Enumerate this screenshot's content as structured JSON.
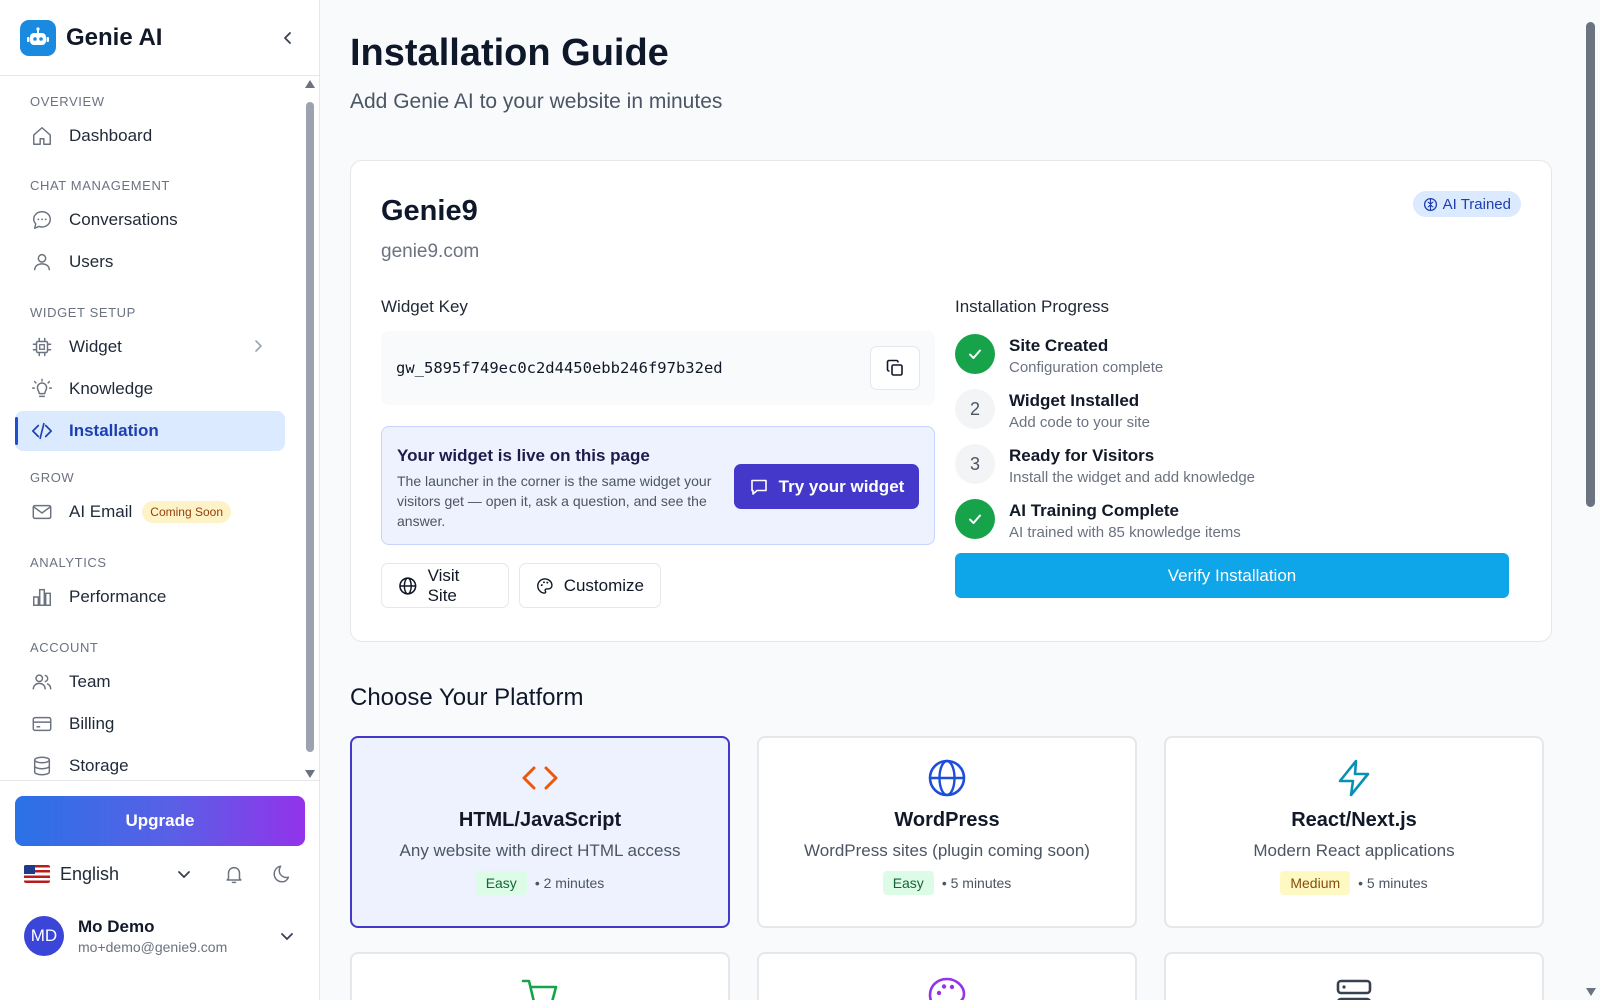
{
  "app": {
    "name": "Genie AI"
  },
  "sidebar": {
    "sections": [
      {
        "label": "OVERVIEW"
      },
      {
        "label": "CHAT MANAGEMENT"
      },
      {
        "label": "WIDGET SETUP"
      },
      {
        "label": "GROW"
      },
      {
        "label": "ANALYTICS"
      },
      {
        "label": "ACCOUNT"
      }
    ],
    "items": {
      "dashboard": "Dashboard",
      "conversations": "Conversations",
      "users": "Users",
      "widget": "Widget",
      "knowledge": "Knowledge",
      "installation": "Installation",
      "ai_email": "AI Email",
      "ai_email_badge": "Coming Soon",
      "performance": "Performance",
      "team": "Team",
      "billing": "Billing",
      "storage": "Storage"
    },
    "active_item": "Installation"
  },
  "footer": {
    "upgrade_label": "Upgrade",
    "language": "English",
    "user": {
      "initials": "MD",
      "name": "Mo Demo",
      "email": "mo+demo@genie9.com"
    }
  },
  "page": {
    "title": "Installation Guide",
    "subtitle": "Add Genie AI to your website in minutes"
  },
  "site": {
    "name": "Genie9",
    "domain": "genie9.com",
    "badge": "AI Trained",
    "widget_key_label": "Widget Key",
    "widget_key": "gw_5895f749ec0c2d4450ebb246f97b32ed",
    "live": {
      "title": "Your widget is live on this page",
      "description": "The launcher in the corner is the same widget your visitors get — open it, ask a question, and see the answer.",
      "button": "Try your widget"
    },
    "visit_label": "Visit Site",
    "customize_label": "Customize"
  },
  "progress": {
    "label": "Installation Progress",
    "steps": [
      {
        "status": "done",
        "marker": "",
        "title": "Site Created",
        "desc": "Configuration complete"
      },
      {
        "status": "todo",
        "marker": "2",
        "title": "Widget Installed",
        "desc": "Add code to your site"
      },
      {
        "status": "todo",
        "marker": "3",
        "title": "Ready for Visitors",
        "desc": "Install the widget and add knowledge"
      },
      {
        "status": "done",
        "marker": "",
        "title": "AI Training Complete",
        "desc": "AI trained with 85 knowledge items"
      }
    ],
    "verify_label": "Verify Installation"
  },
  "platforms": {
    "heading": "Choose Your Platform",
    "items": [
      {
        "name": "HTML/JavaScript",
        "desc": "Any website with direct HTML access",
        "difficulty": "Easy",
        "time": "• 2 minutes",
        "icon": "code-icon",
        "selected": true
      },
      {
        "name": "WordPress",
        "desc": "WordPress sites (plugin coming soon)",
        "difficulty": "Easy",
        "time": "• 5 minutes",
        "icon": "globe-icon",
        "selected": false
      },
      {
        "name": "React/Next.js",
        "desc": "Modern React applications",
        "difficulty": "Medium",
        "time": "• 5 minutes",
        "icon": "lightning-icon",
        "selected": false
      }
    ],
    "partial_icons": [
      "cart-icon",
      "palette-icon",
      "server-icon"
    ]
  },
  "colors": {
    "primary_blue": "#0ea5e9",
    "indigo": "#4338ca",
    "success": "#16a34a",
    "html_icon": "#ea580c",
    "wordpress_icon": "#1d4ed8",
    "react_icon": "#0891b2",
    "cart_icon": "#16a34a",
    "palette_icon": "#9333ea",
    "server_icon": "#374151"
  }
}
